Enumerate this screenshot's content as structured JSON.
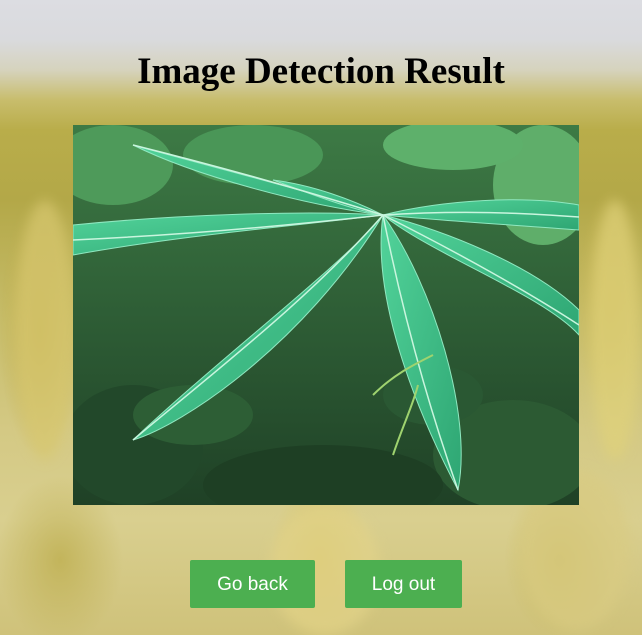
{
  "page": {
    "title": "Image Detection Result"
  },
  "result_image": {
    "subject": "leaf",
    "description_icon": "image"
  },
  "actions": {
    "go_back_label": "Go back",
    "logout_label": "Log out"
  },
  "colors": {
    "button_bg": "#4caf50",
    "button_text": "#ffffff",
    "title_text": "#000000",
    "leaf_primary": "#3fbf86"
  }
}
